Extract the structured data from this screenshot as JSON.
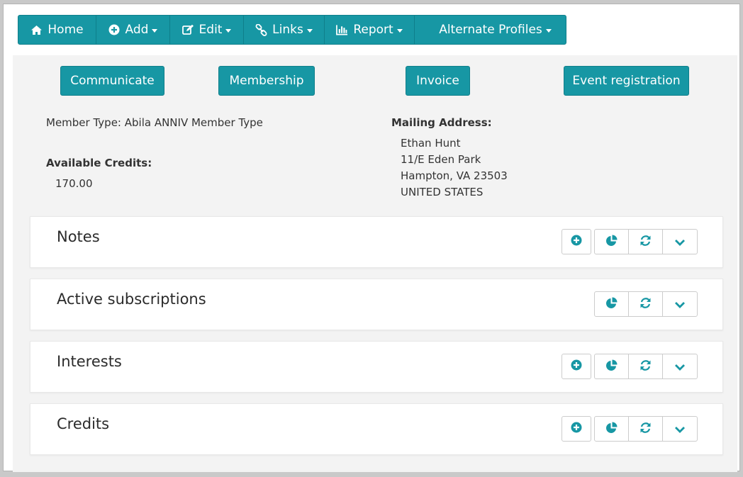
{
  "colors": {
    "accent": "#1797a4",
    "accent_border": "#0f7f8b",
    "panel_bg": "#f3f3f3",
    "icon": "#1797a4"
  },
  "nav": {
    "items": [
      {
        "label": "Home",
        "icon": "home-icon"
      },
      {
        "label": "Add",
        "icon": "plus-circle-icon"
      },
      {
        "label": "Edit",
        "icon": "edit-icon"
      },
      {
        "label": "Links",
        "icon": "link-icon"
      },
      {
        "label": "Report",
        "icon": "bar-chart-icon"
      },
      {
        "label": "Alternate Profiles",
        "icon": ""
      }
    ]
  },
  "actions": {
    "communicate": "Communicate",
    "membership": "Membership",
    "invoice": "Invoice",
    "event_registration": "Event registration"
  },
  "member": {
    "member_type": "Member Type: Abila ANNIV Member Type",
    "credits_label": "Available Credits:",
    "credits_value": "170.00",
    "mailing_label": "Mailing Address:",
    "address": [
      "Ethan Hunt",
      "11/E Eden Park",
      "Hampton, VA 23503",
      "UNITED STATES"
    ]
  },
  "sections": [
    {
      "title": "Notes",
      "buttons": [
        "plus-circle-icon",
        "pie-chart-icon",
        "refresh-icon",
        "chevron-down-icon"
      ]
    },
    {
      "title": "Active subscriptions",
      "buttons": [
        "pie-chart-icon",
        "refresh-icon",
        "chevron-down-icon"
      ]
    },
    {
      "title": "Interests",
      "buttons": [
        "plus-circle-icon",
        "pie-chart-icon",
        "refresh-icon",
        "chevron-down-icon"
      ]
    },
    {
      "title": "Credits",
      "buttons": [
        "plus-circle-icon",
        "pie-chart-icon",
        "refresh-icon",
        "chevron-down-icon"
      ]
    }
  ]
}
